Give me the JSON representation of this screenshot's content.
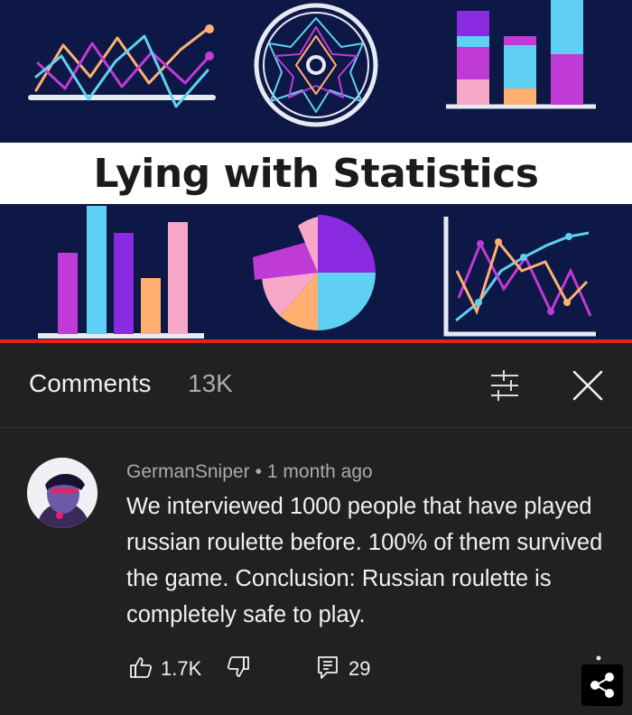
{
  "thumbnail": {
    "title": "Lying with Statistics",
    "colors": {
      "background": "#0d1846",
      "pink": "#f7a8c8",
      "cyan": "#5fd0f3",
      "purple": "#8a2be2",
      "orange": "#ffb070",
      "magenta": "#c03bd6"
    },
    "progress": 1.0
  },
  "comments_panel": {
    "label": "Comments",
    "count": "13K",
    "filter_icon": "filter-icon",
    "close_icon": "close-icon"
  },
  "comment": {
    "author": "GermanSniper",
    "separator": "•",
    "time": "1 month ago",
    "text": "We interviewed 1000 people that have played russian roulette before. 100% of them survived the game. Conclusion: Russian roulette is completely safe to play.",
    "likes": "1.7K",
    "replies": "29",
    "icons": {
      "like": "thumbs-up-icon",
      "dislike": "thumbs-down-icon",
      "reply": "reply-icon",
      "more": "more-vertical-icon",
      "share": "share-icon"
    }
  }
}
